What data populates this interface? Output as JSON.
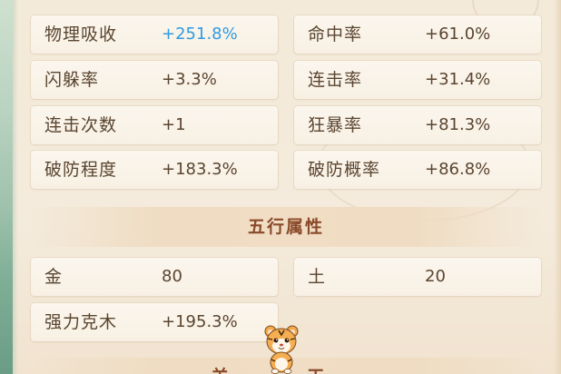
{
  "attributes": [
    {
      "label": "物理吸收",
      "value": "+251.8%",
      "highlight": true
    },
    {
      "label": "命中率",
      "value": "+61.0%"
    },
    {
      "label": "闪躲率",
      "value": "+3.3%"
    },
    {
      "label": "连击率",
      "value": "+31.4%"
    },
    {
      "label": "连击次数",
      "value": "+1"
    },
    {
      "label": "狂暴率",
      "value": "+81.3%"
    },
    {
      "label": "破防程度",
      "value": "+183.3%"
    },
    {
      "label": "破防概率",
      "value": "+86.8%"
    }
  ],
  "five_elements": {
    "title": "五行属性",
    "items": [
      {
        "label": "金",
        "value": "80"
      },
      {
        "label": "土",
        "value": "20"
      },
      {
        "label": "强力克木",
        "value": "+195.3%"
      }
    ]
  },
  "next_section": {
    "title": "羊 工"
  },
  "mascot_icon": "tiger-mascot",
  "colors": {
    "highlight_value": "#2f9be2",
    "text": "#5a4530",
    "section_title": "#8a4a2a"
  }
}
